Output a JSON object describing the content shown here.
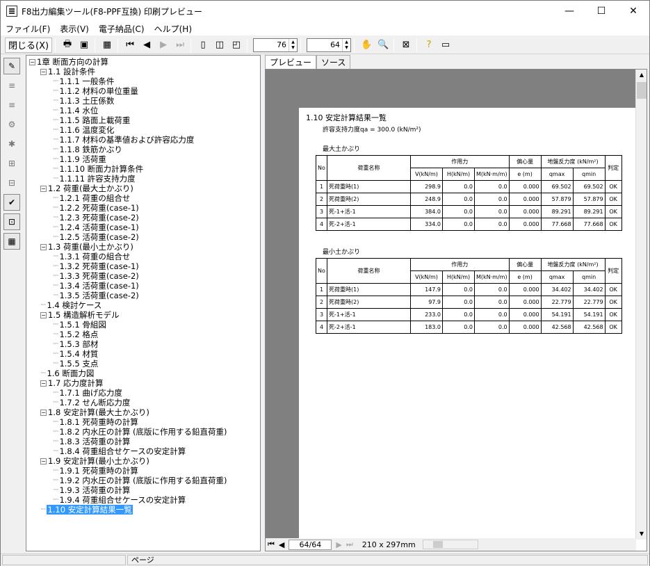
{
  "window": {
    "title": "F8出力編集ツール(F8-PPF互換) 印刷プレビュー",
    "minimize": "—",
    "maximize": "☐",
    "close": "✕"
  },
  "menu": [
    "ファイル(F)",
    "表示(V)",
    "電子納品(C)",
    "ヘルプ(H)"
  ],
  "toolbar": {
    "close_label": "閉じる(X)",
    "zoom_value": "76",
    "page_value": "64"
  },
  "tree": [
    {
      "label": "1章 断面方向の計算",
      "level": 0,
      "exp": "−"
    },
    {
      "label": "1.1 設計条件",
      "level": 1,
      "exp": "−"
    },
    {
      "label": "1.1.1 一般条件",
      "level": 2
    },
    {
      "label": "1.1.2 材料の単位重量",
      "level": 2
    },
    {
      "label": "1.1.3 土圧係数",
      "level": 2
    },
    {
      "label": "1.1.4 水位",
      "level": 2
    },
    {
      "label": "1.1.5 路面上載荷重",
      "level": 2
    },
    {
      "label": "1.1.6 温度変化",
      "level": 2
    },
    {
      "label": "1.1.7 材料の基準値および許容応力度",
      "level": 2
    },
    {
      "label": "1.1.8 鉄筋かぶり",
      "level": 2
    },
    {
      "label": "1.1.9 活荷重",
      "level": 2
    },
    {
      "label": "1.1.10 断面力計算条件",
      "level": 2
    },
    {
      "label": "1.1.11 許容支持力度",
      "level": 2
    },
    {
      "label": "1.2 荷重(最大土かぶり)",
      "level": 1,
      "exp": "−"
    },
    {
      "label": "1.2.1 荷重の組合せ",
      "level": 2
    },
    {
      "label": "1.2.2 死荷重(case-1)",
      "level": 2
    },
    {
      "label": "1.2.3 死荷重(case-2)",
      "level": 2
    },
    {
      "label": "1.2.4 活荷重(case-1)",
      "level": 2
    },
    {
      "label": "1.2.5 活荷重(case-2)",
      "level": 2
    },
    {
      "label": "1.3 荷重(最小土かぶり)",
      "level": 1,
      "exp": "−"
    },
    {
      "label": "1.3.1 荷重の組合せ",
      "level": 2
    },
    {
      "label": "1.3.2 死荷重(case-1)",
      "level": 2
    },
    {
      "label": "1.3.3 死荷重(case-2)",
      "level": 2
    },
    {
      "label": "1.3.4 活荷重(case-1)",
      "level": 2
    },
    {
      "label": "1.3.5 活荷重(case-2)",
      "level": 2
    },
    {
      "label": "1.4 検討ケース",
      "level": 1
    },
    {
      "label": "1.5 構造解析モデル",
      "level": 1,
      "exp": "−"
    },
    {
      "label": "1.5.1 骨組図",
      "level": 2
    },
    {
      "label": "1.5.2 格点",
      "level": 2
    },
    {
      "label": "1.5.3 部材",
      "level": 2
    },
    {
      "label": "1.5.4 材質",
      "level": 2
    },
    {
      "label": "1.5.5 支点",
      "level": 2
    },
    {
      "label": "1.6 断面力図",
      "level": 1
    },
    {
      "label": "1.7 応力度計算",
      "level": 1,
      "exp": "−"
    },
    {
      "label": "1.7.1 曲げ応力度",
      "level": 2
    },
    {
      "label": "1.7.2 せん断応力度",
      "level": 2
    },
    {
      "label": "1.8 安定計算(最大土かぶり)",
      "level": 1,
      "exp": "−"
    },
    {
      "label": "1.8.1 死荷重時の計算",
      "level": 2
    },
    {
      "label": "1.8.2 内水圧の計算 (底版に作用する鉛直荷重)",
      "level": 2
    },
    {
      "label": "1.8.3 活荷重の計算",
      "level": 2
    },
    {
      "label": "1.8.4 荷重組合せケースの安定計算",
      "level": 2
    },
    {
      "label": "1.9 安定計算(最小土かぶり)",
      "level": 1,
      "exp": "−"
    },
    {
      "label": "1.9.1 死荷重時の計算",
      "level": 2
    },
    {
      "label": "1.9.2 内水圧の計算 (底版に作用する鉛直荷重)",
      "level": 2
    },
    {
      "label": "1.9.3 活荷重の計算",
      "level": 2
    },
    {
      "label": "1.9.4 荷重組合せケースの安定計算",
      "level": 2
    },
    {
      "label": "1.10 安定計算結果一覧",
      "level": 1,
      "sel": true
    }
  ],
  "tabs": {
    "preview": "プレビュー",
    "source": "ソース"
  },
  "page": {
    "title": "1.10 安定計算結果一覧",
    "subtitle": "許容支持力度qa = 300.0 (kN/m²)",
    "hdr": {
      "no": "No",
      "name": "荷重名称",
      "force": "作用力",
      "v": "V(kN/m)",
      "h": "H(kN/m)",
      "m": "M(kN·m/m)",
      "ecc": "偏心量",
      "e": "e (m)",
      "soil": "地盤反力度 (kN/m²)",
      "qmax": "qmax",
      "qmin": "qmin",
      "judge": "判定"
    },
    "table1": {
      "caption": "最大土かぶり",
      "rows": [
        [
          "1",
          "死荷重時(1)",
          "298.9",
          "0.0",
          "0.0",
          "0.000",
          "69.502",
          "69.502",
          "OK"
        ],
        [
          "2",
          "死荷重時(2)",
          "248.9",
          "0.0",
          "0.0",
          "0.000",
          "57.879",
          "57.879",
          "OK"
        ],
        [
          "3",
          "死-1+活-1",
          "384.0",
          "0.0",
          "0.0",
          "0.000",
          "89.291",
          "89.291",
          "OK"
        ],
        [
          "4",
          "死-2+活-1",
          "334.0",
          "0.0",
          "0.0",
          "0.000",
          "77.668",
          "77.668",
          "OK"
        ]
      ]
    },
    "table2": {
      "caption": "最小土かぶり",
      "rows": [
        [
          "1",
          "死荷重時(1)",
          "147.9",
          "0.0",
          "0.0",
          "0.000",
          "34.402",
          "34.402",
          "OK"
        ],
        [
          "2",
          "死荷重時(2)",
          "97.9",
          "0.0",
          "0.0",
          "0.000",
          "22.779",
          "22.779",
          "OK"
        ],
        [
          "3",
          "死-1+活-1",
          "233.0",
          "0.0",
          "0.0",
          "0.000",
          "54.191",
          "54.191",
          "OK"
        ],
        [
          "4",
          "死-2+活-1",
          "183.0",
          "0.0",
          "0.0",
          "0.000",
          "42.568",
          "42.568",
          "OK"
        ]
      ]
    }
  },
  "pager": {
    "page": "64/64",
    "size": "210 x 297mm"
  },
  "status": {
    "label": "ページ"
  }
}
